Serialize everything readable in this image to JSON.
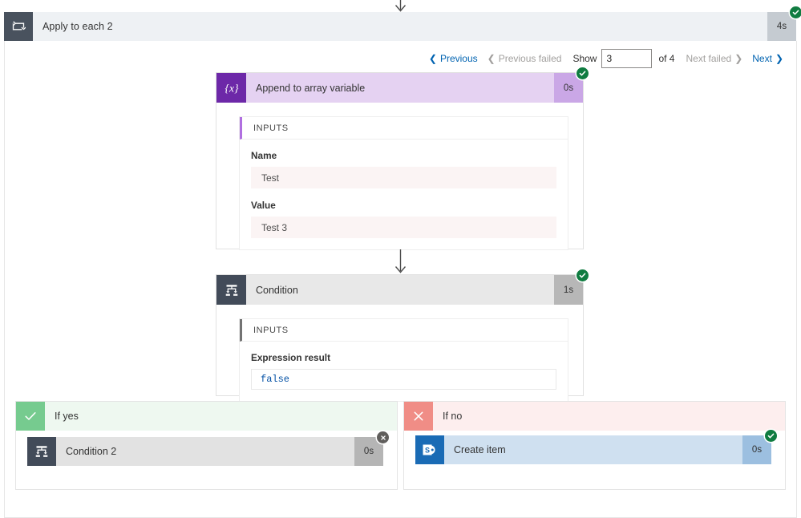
{
  "scope": {
    "title": "Apply to each 2",
    "duration": "4s",
    "status": "succeeded",
    "icon": "apply-to-each-icon"
  },
  "pager": {
    "previous": "Previous",
    "previous_failed": "Previous failed",
    "show_label": "Show",
    "current_page": "3",
    "of_label": "of 4",
    "next_failed": "Next failed",
    "next": "Next",
    "link_color": "#0063b1",
    "disabled_color": "#a19f9d"
  },
  "actions": [
    {
      "name": "Append to array variable",
      "duration": "0s",
      "status": "succeeded",
      "icon": "variable-braces-icon",
      "header_color": "#e5d2f2",
      "icon_color": "#6d28a8",
      "panel": {
        "title": "INPUTS",
        "fields": [
          {
            "label": "Name",
            "value": "Test"
          },
          {
            "label": "Value",
            "value": "Test 3"
          }
        ]
      }
    },
    {
      "name": "Condition",
      "duration": "1s",
      "status": "succeeded",
      "icon": "condition-branch-icon",
      "header_color": "#e8e8e8",
      "icon_color": "#424b59",
      "panel": {
        "title": "INPUTS",
        "expression_label": "Expression result",
        "expression_value": "false"
      }
    }
  ],
  "branches": [
    {
      "label": "If yes",
      "icon": "check-icon",
      "header_color": "#eef8f0",
      "icon_color": "#76cb8f",
      "child": {
        "name": "Condition 2",
        "duration": "0s",
        "status": "skipped",
        "icon": "condition-branch-icon"
      }
    },
    {
      "label": "If no",
      "icon": "cross-icon",
      "header_color": "#fdeeee",
      "icon_color": "#f08d86",
      "child": {
        "name": "Create item",
        "duration": "0s",
        "status": "succeeded",
        "icon": "sharepoint-icon"
      }
    }
  ]
}
